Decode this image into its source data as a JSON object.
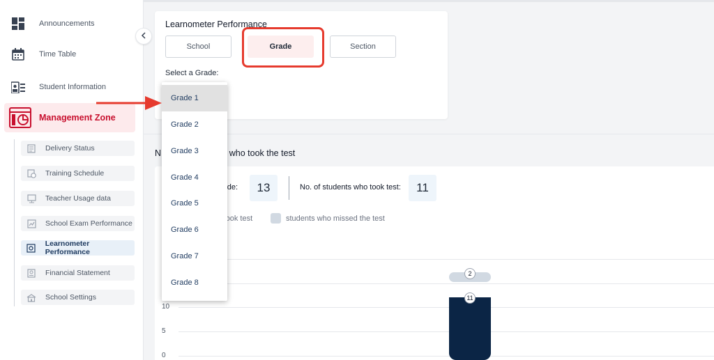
{
  "sidebar": {
    "top_items": [
      {
        "label": "Announcements",
        "icon": "grid-icon"
      },
      {
        "label": "Time Table",
        "icon": "calendar-icon"
      },
      {
        "label": "Student Information",
        "icon": "id-card-icon"
      }
    ],
    "management_zone": {
      "label": "Management Zone",
      "icon": "dashboard-icon"
    },
    "sub_items": [
      {
        "label": "Delivery Status",
        "icon": "document-icon"
      },
      {
        "label": "Training Schedule",
        "icon": "clock-calendar-icon"
      },
      {
        "label": "Teacher Usage data",
        "icon": "presentation-icon"
      },
      {
        "label": "School Exam Performance",
        "icon": "chart-icon"
      },
      {
        "label": "Learnometer Performance",
        "icon": "gauge-icon",
        "active": true
      },
      {
        "label": "Financial Statement",
        "icon": "statement-icon"
      },
      {
        "label": "School Settings",
        "icon": "school-icon"
      }
    ]
  },
  "filter_card": {
    "title": "Learnometer Performance",
    "segments": [
      {
        "label": "School",
        "selected": false
      },
      {
        "label": "Grade",
        "selected": true
      },
      {
        "label": "Section",
        "selected": false
      }
    ],
    "select_label": "Select a Grade:"
  },
  "dropdown": {
    "options": [
      "Grade 1",
      "Grade 2",
      "Grade 3",
      "Grade 4",
      "Grade 5",
      "Grade 6",
      "Grade 7",
      "Grade 8"
    ],
    "highlighted": "Grade 1"
  },
  "results": {
    "title_visible_left": "N",
    "title_visible_right": "s who took the test",
    "stat1_label_visible": "rade:",
    "stat1_value": "13",
    "stat2_label": "No. of students who took test:",
    "stat2_value": "11",
    "legend_took_visible": "s took test",
    "legend_missed": "students who missed the test"
  },
  "chart_data": {
    "type": "bar",
    "stacked": true,
    "y_ticks": [
      "0",
      "5",
      "10"
    ],
    "series": [
      {
        "name": "students who missed the test",
        "values": [
          2
        ],
        "color": "#d1d9e2"
      },
      {
        "values": [
          11
        ],
        "color": "#0b2545"
      }
    ],
    "bar_labels": [
      "2",
      "11"
    ]
  },
  "colors": {
    "accent_red": "#c8102e",
    "annotation_red": "#e63b2e",
    "navy": "#0b2545"
  }
}
